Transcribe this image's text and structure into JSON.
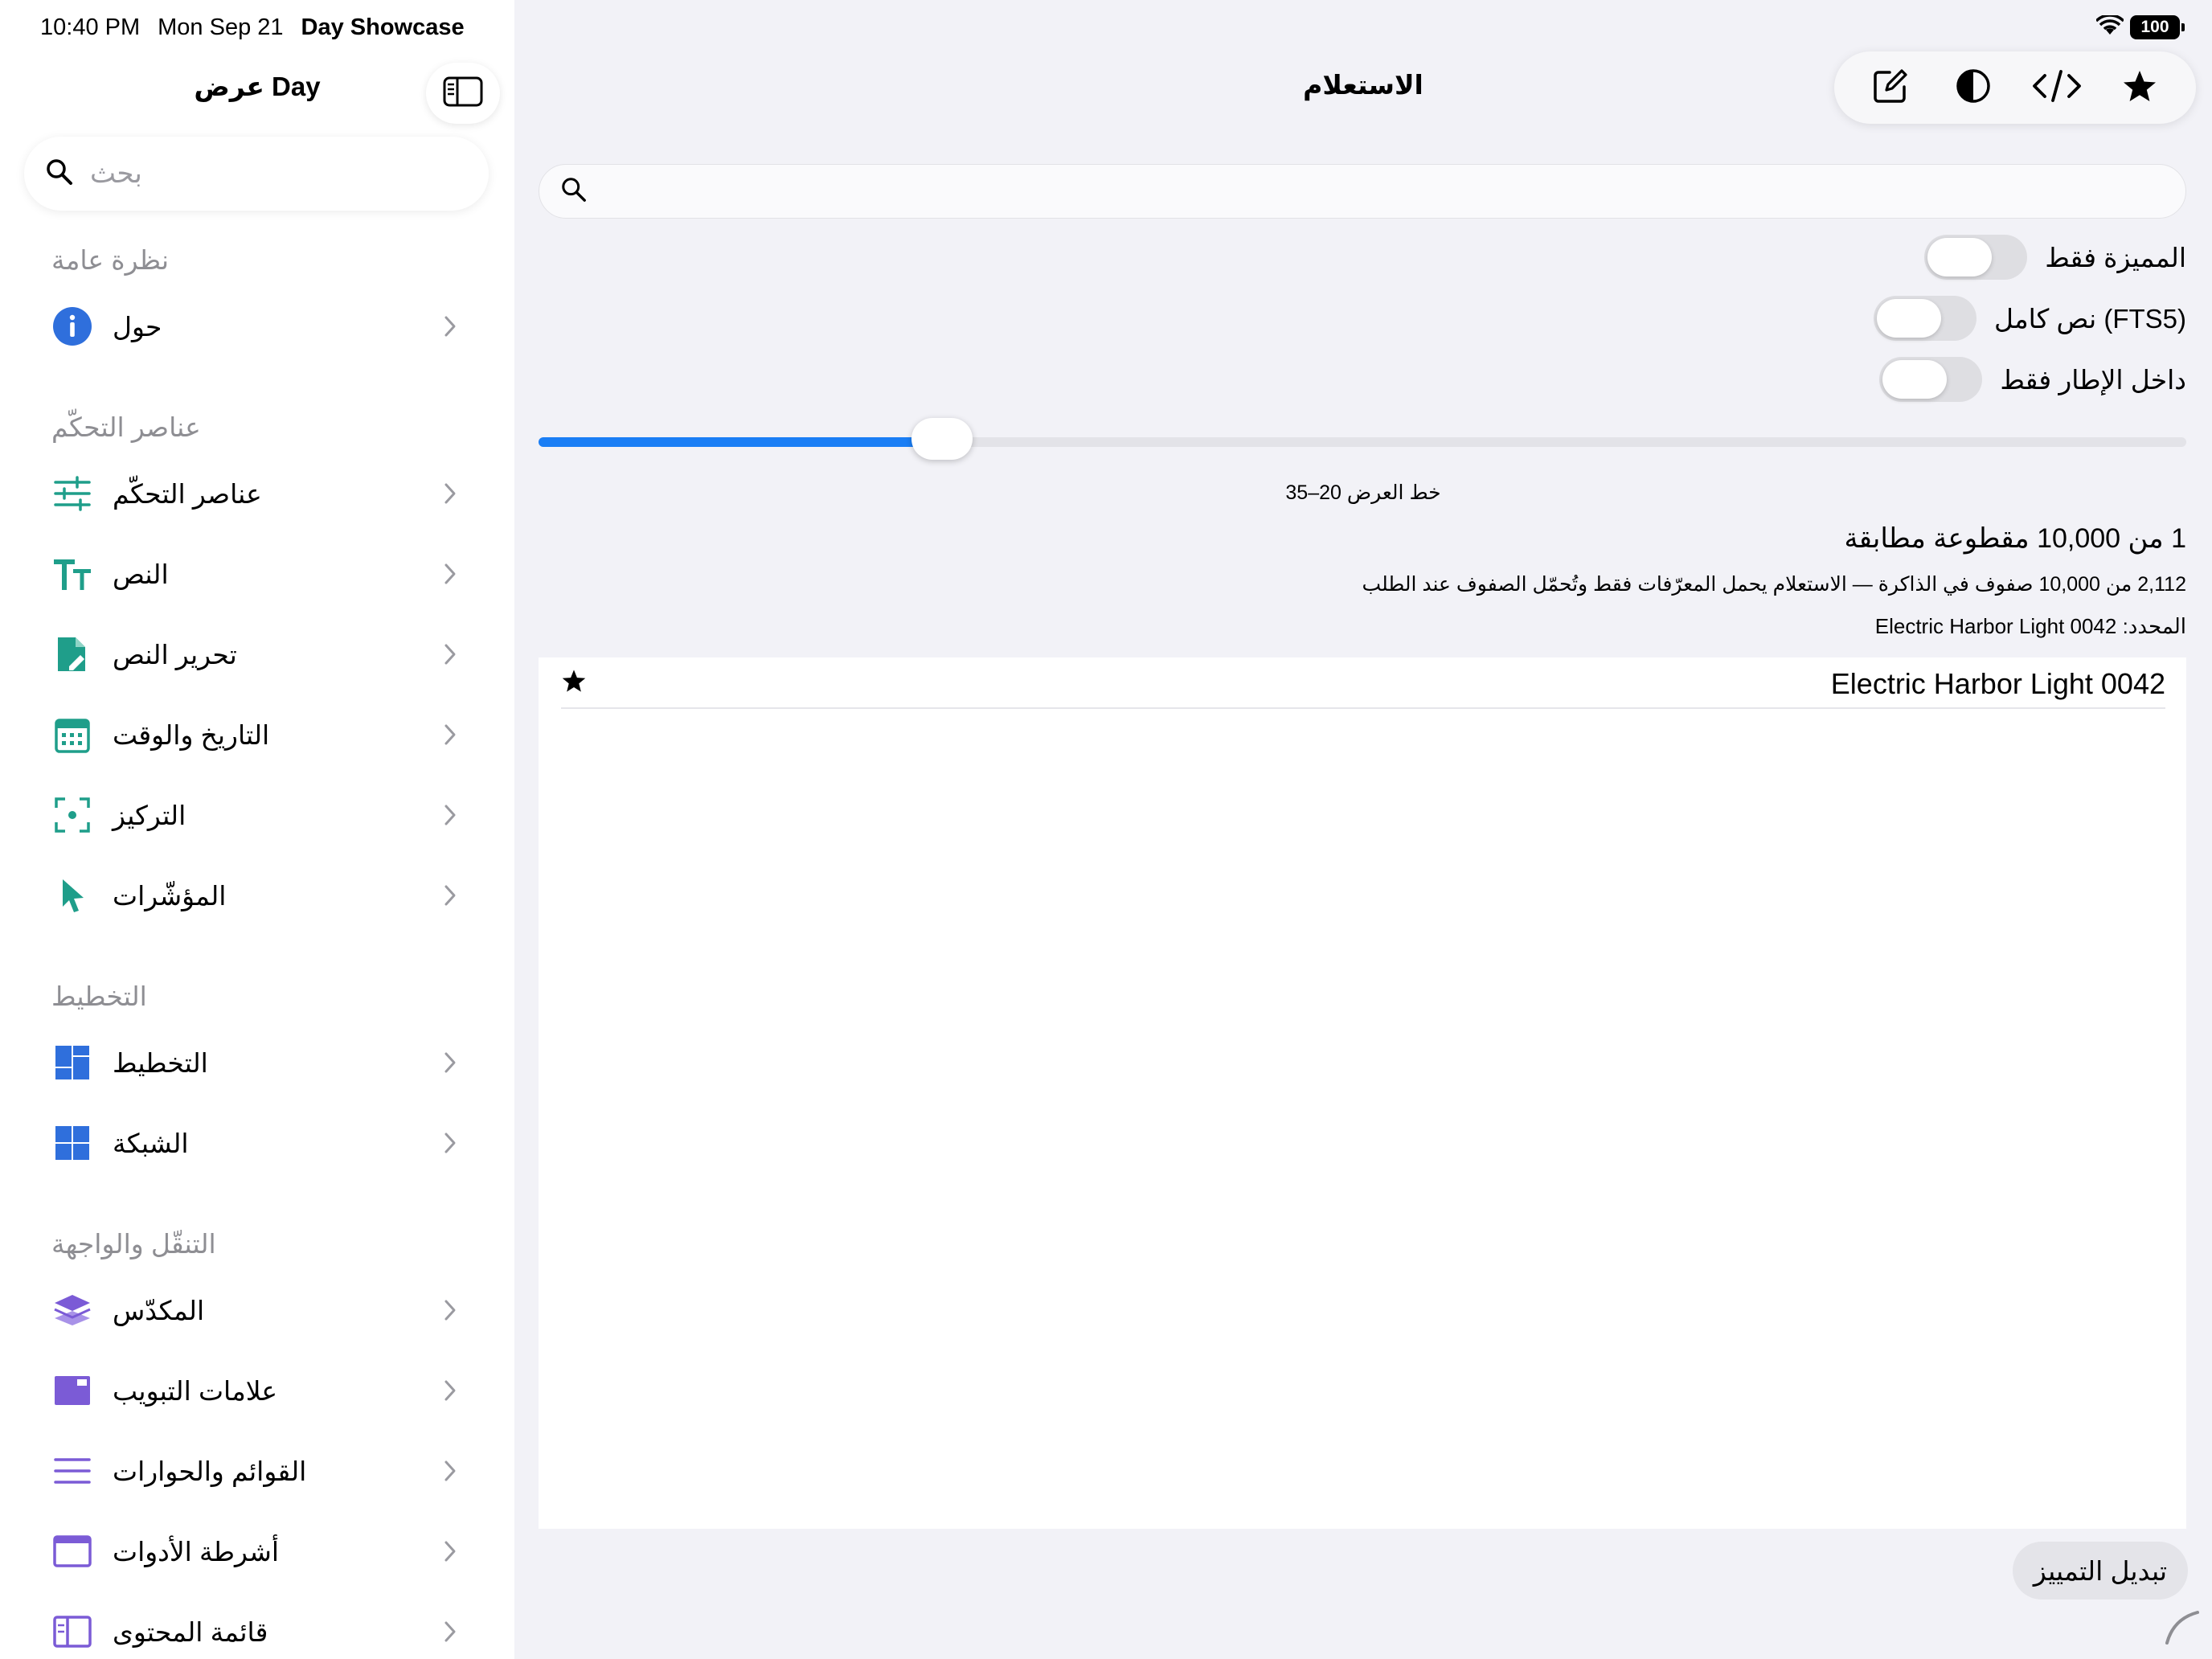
{
  "status_bar": {
    "time": "10:40 PM",
    "date": "Mon Sep 21",
    "app_name": "Day Showcase",
    "battery": "100"
  },
  "sidebar": {
    "title": "عرض Day",
    "search_placeholder": "بحث",
    "sections": [
      {
        "header": "نظرة عامة",
        "items": [
          {
            "label": "حول",
            "icon": "info-icon"
          }
        ]
      },
      {
        "header": "عناصر التحكّم",
        "items": [
          {
            "label": "عناصر التحكّم",
            "icon": "sliders-icon"
          },
          {
            "label": "النص",
            "icon": "text-size-icon"
          },
          {
            "label": "تحرير النص",
            "icon": "edit-document-icon"
          },
          {
            "label": "التاريخ والوقت",
            "icon": "calendar-icon"
          },
          {
            "label": "التركيز",
            "icon": "focus-icon"
          },
          {
            "label": "المؤشّرات",
            "icon": "pointer-icon"
          }
        ]
      },
      {
        "header": "التخطيط",
        "items": [
          {
            "label": "التخطيط",
            "icon": "layout-icon"
          },
          {
            "label": "الشبكة",
            "icon": "grid-icon"
          }
        ]
      },
      {
        "header": "التنقّل والواجهة",
        "items": [
          {
            "label": "المكدّس",
            "icon": "stack-icon"
          },
          {
            "label": "علامات التبويب",
            "icon": "tabs-icon"
          },
          {
            "label": "القوائم والحوارات",
            "icon": "menu-lines-icon"
          },
          {
            "label": "أشرطة الأدوات",
            "icon": "toolbar-icon"
          },
          {
            "label": "قائمة المحتوى",
            "icon": "content-list-icon"
          }
        ]
      }
    ]
  },
  "main": {
    "title": "الاستعلام",
    "toolbar": [
      "compose-icon",
      "contrast-icon",
      "code-icon",
      "star-icon"
    ],
    "search_value": "",
    "toggles": [
      {
        "label": "المميزة فقط",
        "on": false
      },
      {
        "label": "نص كامل (FTS5)",
        "on": false
      },
      {
        "label": "داخل الإطار فقط",
        "on": false
      }
    ],
    "slider": {
      "value_fraction": 0.245,
      "caption": "خط العرض 20–35"
    },
    "match_count": "1 من 10,000 مقطوعة مطابقة",
    "info": "2,112 من 10,000 صفوف في الذاكرة — الاستعلام يحمل المعرّفات فقط وتُحمّل الصفوف عند الطلب",
    "selected": "المحدد: Electric Harbor Light 0042",
    "results": [
      {
        "name": "Electric Harbor Light 0042",
        "starred": true
      }
    ],
    "highlight_button": "تبديل التمييز"
  },
  "colors": {
    "accent": "#1a7ef5",
    "teal": "#1f9e8a",
    "blue_icon": "#2f6fdc",
    "purple_icon": "#7b5bd6",
    "secondary_text": "#8e8e93"
  }
}
